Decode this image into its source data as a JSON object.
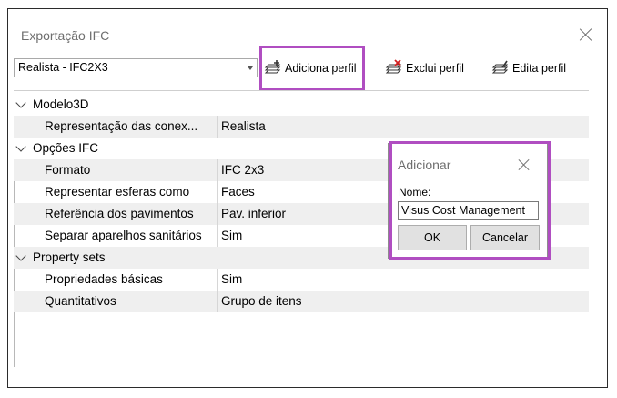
{
  "window": {
    "title": "Exportação IFC"
  },
  "toolbar": {
    "profile_selected": "Realista - IFC2X3",
    "add_label": "Adiciona perfil",
    "delete_label": "Exclui perfil",
    "edit_label": "Edita perfil"
  },
  "grid": {
    "categories": [
      {
        "label": "Modelo3D",
        "rows": [
          {
            "name": "Representação das conex...",
            "value": "Realista"
          }
        ]
      },
      {
        "label": "Opções IFC",
        "rows": [
          {
            "name": "Formato",
            "value": "IFC 2x3"
          },
          {
            "name": "Representar esferas como",
            "value": "Faces"
          },
          {
            "name": "Referência dos pavimentos",
            "value": "Pav. inferior"
          },
          {
            "name": "Separar aparelhos sanitários",
            "value": "Sim"
          }
        ]
      },
      {
        "label": "Property sets",
        "rows": [
          {
            "name": "Propriedades básicas",
            "value": "Sim"
          },
          {
            "name": "Quantitativos",
            "value": "Grupo de itens"
          }
        ]
      }
    ]
  },
  "dialog": {
    "title": "Adicionar",
    "field_label": "Nome:",
    "field_value": "Visus Cost Management",
    "ok_label": "OK",
    "cancel_label": "Cancelar"
  },
  "icons": {
    "close": "close-icon",
    "add": "add-profile-icon",
    "delete": "delete-profile-icon",
    "edit": "edit-profile-icon",
    "expand": "chevron-down-icon"
  },
  "colors": {
    "highlight": "#b04ec1",
    "alt_row": "#efefef"
  }
}
